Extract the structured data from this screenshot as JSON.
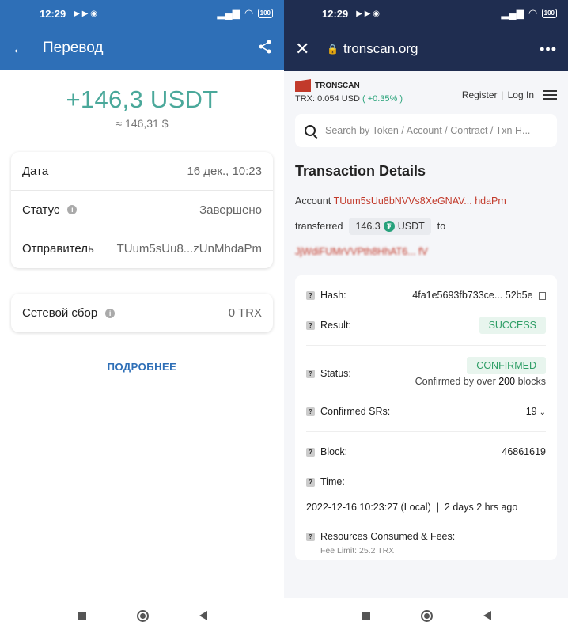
{
  "left": {
    "status_time": "12:29",
    "battery": "100",
    "title": "Перевод",
    "amount": "+146,3 USDT",
    "approx": "≈ 146,31 $",
    "rows": [
      {
        "label": "Дата",
        "value": "16 дек., 10:23"
      },
      {
        "label": "Статус",
        "value": "Завершено"
      },
      {
        "label": "Отправитель",
        "value": "TUum5sUu8...zUnMhdaPm"
      }
    ],
    "fee": {
      "label": "Сетевой сбор",
      "value": "0 TRX"
    },
    "more_label": "ПОДРОБНЕЕ"
  },
  "right": {
    "status_time": "12:29",
    "battery": "100",
    "url": "tronscan.org",
    "brand": "TRONSCAN",
    "price_label": "TRX: 0.054 USD",
    "price_change": "( +0.35% )",
    "register": "Register",
    "login": "Log In",
    "search_placeholder": "Search by Token / Account / Contract / Txn H...",
    "section_title": "Transaction Details",
    "account_label": "Account",
    "account_addr": "TUum5sUu8bNVVs8XeGNAV... hdaPm",
    "transferred_label": "transferred",
    "amount": "146.3",
    "token": "USDT",
    "to_label": "to",
    "to_addr": "JjWdiFUMrVVPth8HhAT6... fV",
    "hash_label": "Hash:",
    "hash_value": "4fa1e5693fb733ce... 52b5e",
    "result_label": "Result:",
    "result_value": "SUCCESS",
    "status_label": "Status:",
    "status_value": "CONFIRMED",
    "confirmed_by_prefix": "Confirmed by over",
    "confirmed_by_count": "200",
    "confirmed_by_suffix": "blocks",
    "srs_label": "Confirmed SRs:",
    "srs_value": "19",
    "block_label": "Block:",
    "block_value": "46861619",
    "time_label": "Time:",
    "time_value": "2022-12-16 10:23:27 (Local)",
    "time_ago": "2 days 2 hrs ago",
    "resources_label": "Resources Consumed & Fees:",
    "fee_limit": "Fee Limit: 25.2 TRX"
  }
}
